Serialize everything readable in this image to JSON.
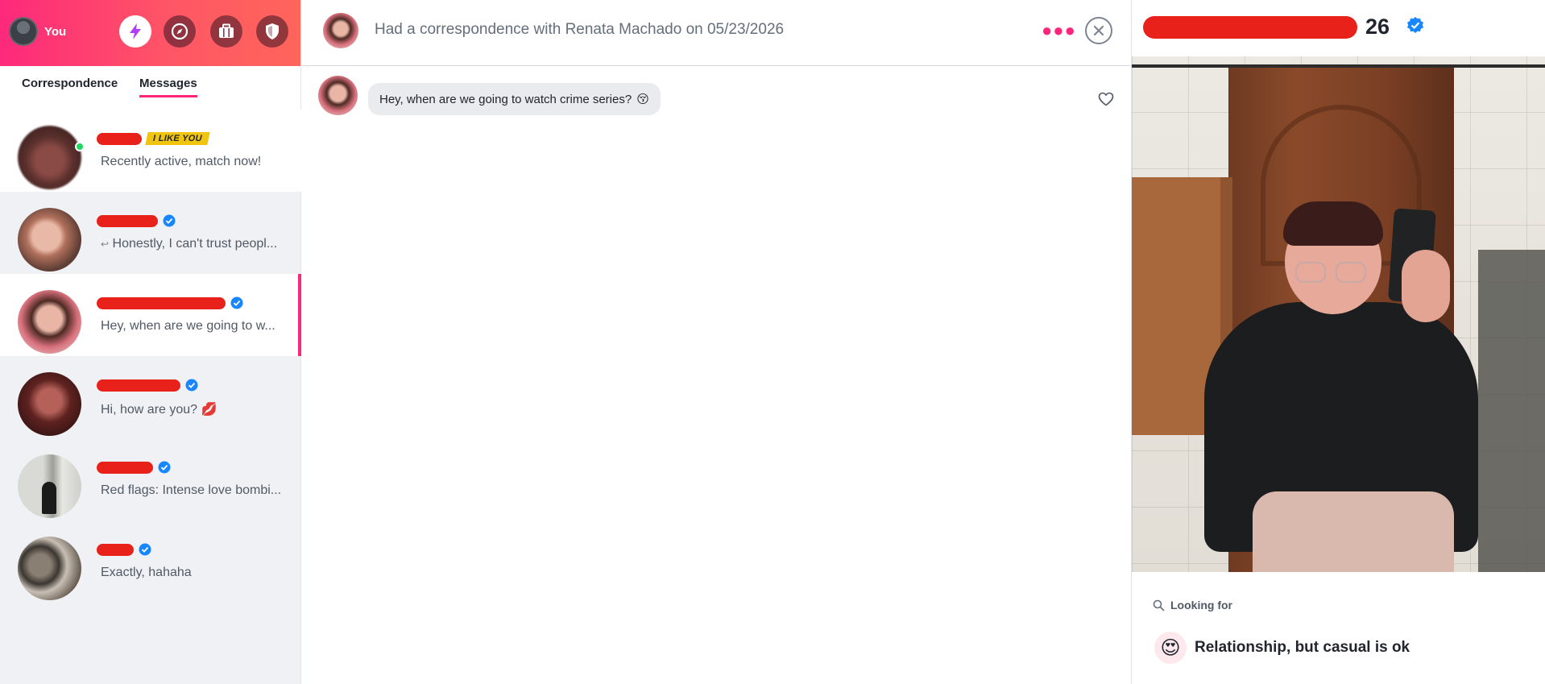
{
  "sidebar": {
    "me_label": "You",
    "tabs": [
      {
        "label": "Correspondence",
        "selected": false
      },
      {
        "label": "Messages",
        "selected": true
      }
    ],
    "conversations": [
      {
        "preview": "Recently active, match now!",
        "badge": "I LIKE YOU",
        "online": true,
        "verified": false
      },
      {
        "preview": "Honestly, I can't trust peopl...",
        "reply_icon": "reply-arrow-icon",
        "verified": true
      },
      {
        "preview": "Hey, when are we going to w...",
        "verified": true,
        "selected": true
      },
      {
        "preview": "Hi, how are you?",
        "emoji": "💋",
        "verified": true
      },
      {
        "preview": "Red flags: Intense love bombi...",
        "verified": true
      },
      {
        "preview": "Exactly, hahaha",
        "verified": true
      }
    ]
  },
  "chat": {
    "header_title": "Had a correspondence with Renata Machado on 05/23/2026",
    "messages": [
      {
        "text": "Hey, when are we going to watch crime series?",
        "emoji": "😚"
      }
    ]
  },
  "profile": {
    "age": "26",
    "looking_for_label": "Looking for",
    "looking_for_value": "Relationship, but casual is ok",
    "looking_for_emoji": "😍"
  },
  "colors": {
    "brand_gradient_start": "#fd297b",
    "brand_gradient_end": "#ff655b",
    "accent": "#fd267a",
    "verified_blue": "#1786ff",
    "redaction": "#e8221b"
  }
}
